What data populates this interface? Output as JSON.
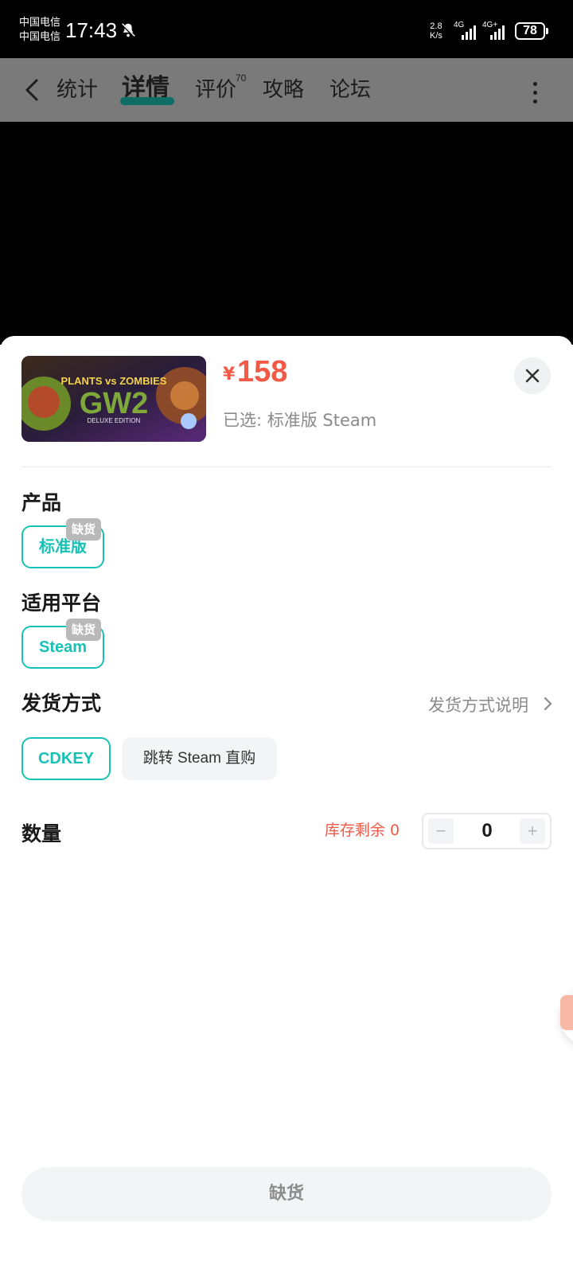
{
  "status_bar": {
    "carrier_1": "中国电信",
    "carrier_2": "中国电信",
    "time": "17:43",
    "net_speed_value": "2.8",
    "net_speed_unit": "K/s",
    "sim1_label": "4G",
    "sim2_label": "4G+",
    "battery": "78"
  },
  "nav": {
    "tabs": [
      {
        "label": "统计"
      },
      {
        "label": "详情"
      },
      {
        "label": "评价"
      },
      {
        "label": "攻略"
      },
      {
        "label": "论坛"
      }
    ],
    "review_count": "70",
    "active_tab": "详情"
  },
  "product": {
    "thumbnail_title_1": "PLANTS vs ZOMBIES",
    "thumbnail_title_2": "GW2",
    "thumbnail_subtitle": "DELUXE EDITION",
    "currency_symbol": "¥",
    "price": "158",
    "selected_text": "已选: 标准版 Steam"
  },
  "sections": {
    "product_title": "产品",
    "product_option": "标准版",
    "platform_title": "适用平台",
    "platform_option": "Steam",
    "out_of_stock_badge": "缺货",
    "shipping_title": "发货方式",
    "shipping_link": "发货方式说明",
    "shipping_options": [
      "CDKEY",
      "跳转 Steam 直购"
    ],
    "quantity_title": "数量",
    "stock_text": "库存剩余 0",
    "quantity_value": "0",
    "decrement_label": "−",
    "increment_label": "+"
  },
  "footer": {
    "button_label": "缺货"
  },
  "colors": {
    "accent": "#18c1b5",
    "price": "#f05a47",
    "tab_underline": "#0e6e66",
    "overlay": "#7a7a7a"
  }
}
